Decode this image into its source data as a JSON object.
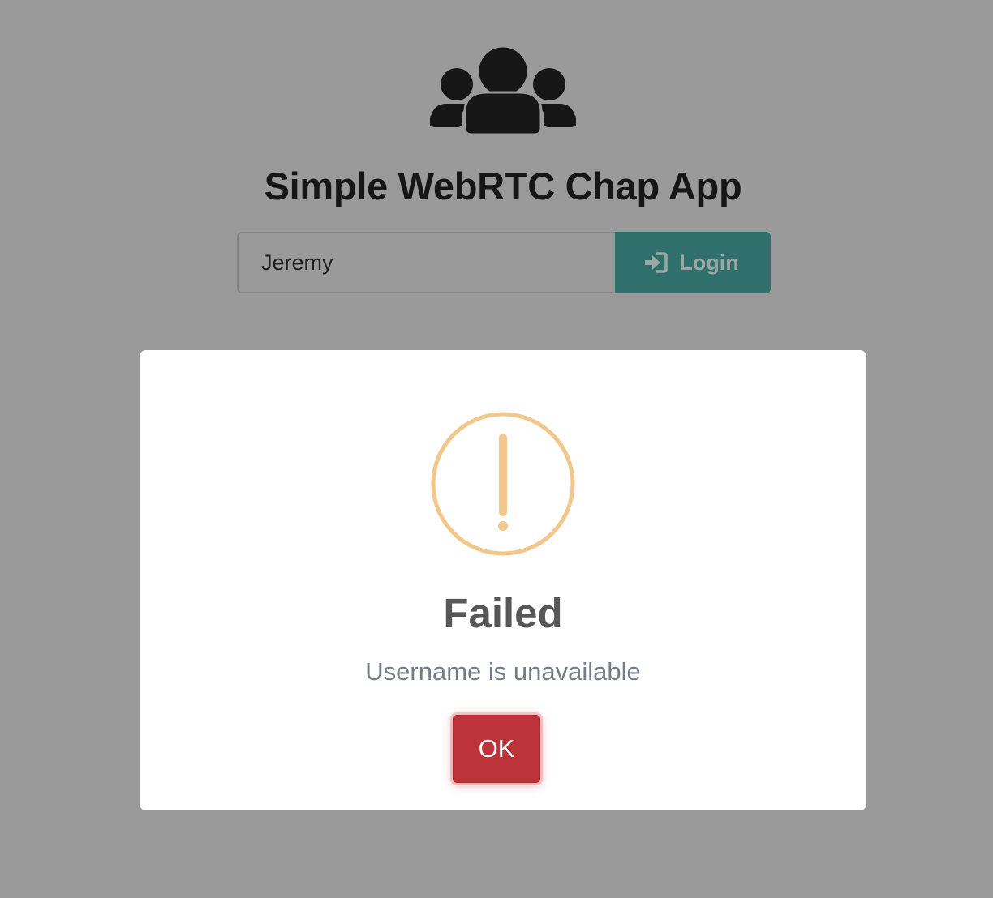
{
  "app": {
    "title": "Simple WebRTC Chap App",
    "header_icon": "users-icon"
  },
  "login": {
    "username_value": "Jeremy",
    "button_label": "Login",
    "button_icon": "sign-in-icon"
  },
  "dialog": {
    "icon": "warning-exclamation-icon",
    "title": "Failed",
    "message": "Username is unavailable",
    "confirm_label": "OK"
  },
  "colors": {
    "overlay_background": "#9a9a9a",
    "login_button": "#2f6f6c",
    "warning_icon": "#f2c78c",
    "confirm_button": "#bd333a"
  }
}
